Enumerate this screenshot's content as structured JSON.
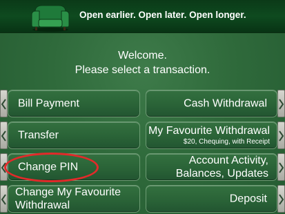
{
  "banner": {
    "slogan": "Open earlier. Open later. Open longer."
  },
  "welcome": {
    "line1": "Welcome.",
    "line2": "Please select a transaction."
  },
  "left_buttons": [
    {
      "label": "Bill Payment"
    },
    {
      "label": "Transfer"
    },
    {
      "label": "Change PIN"
    },
    {
      "label_line1": "Change My Favourite",
      "label_line2": "Withdrawal"
    }
  ],
  "right_buttons": [
    {
      "label": "Cash Withdrawal"
    },
    {
      "label": "My Favourite Withdrawal",
      "sublabel": "$20, Chequing, with Receipt"
    },
    {
      "label_line1": "Account Activity,",
      "label_line2": "Balances, Updates"
    },
    {
      "label": "Deposit"
    }
  ],
  "colors": {
    "annotation_circle": "#e22a2a",
    "background": "#2f6a3b"
  }
}
